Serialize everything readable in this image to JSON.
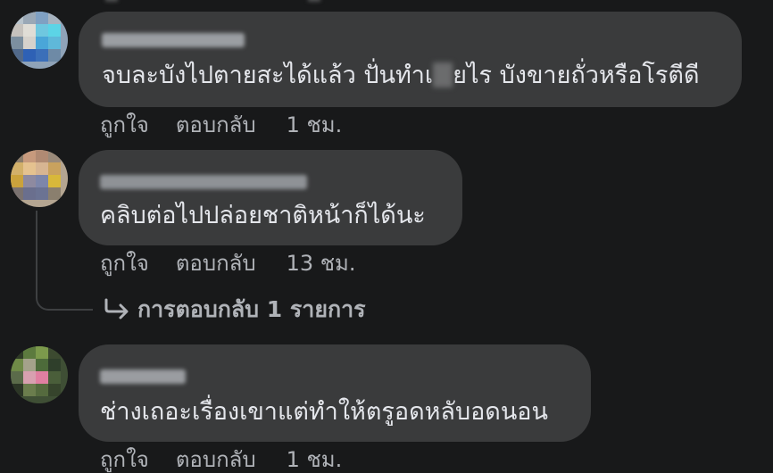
{
  "comments": [
    {
      "text_before": "จบละบังไปตายสะได้แล้ว ปั่นทำเ",
      "text_after": "ยไร บังขายถั่วหรือโรตีดี",
      "like": "ถูกใจ",
      "reply": "ตอบกลับ",
      "time": "1 ชม."
    },
    {
      "text": "คลิบต่อไปปล่อยชาติหน้าก็ได้นะ",
      "like": "ถูกใจ",
      "reply": "ตอบกลับ",
      "time": "13 ชม.",
      "replies_link": "การตอบกลับ 1 รายการ"
    },
    {
      "text": "ช่างเถอะเรื่องเขาแต่ทำให้ตรูอดหลับอดนอน",
      "like": "ถูกใจ",
      "reply": "ตอบกลับ",
      "time": "1 ชม."
    }
  ],
  "colors": {
    "background": "#18191a",
    "bubble": "#3a3b3c",
    "primary_text": "#e4e6eb",
    "secondary_text": "#b0b3b8"
  },
  "icons": {
    "reply_arrow": "reply-arrow-icon"
  }
}
